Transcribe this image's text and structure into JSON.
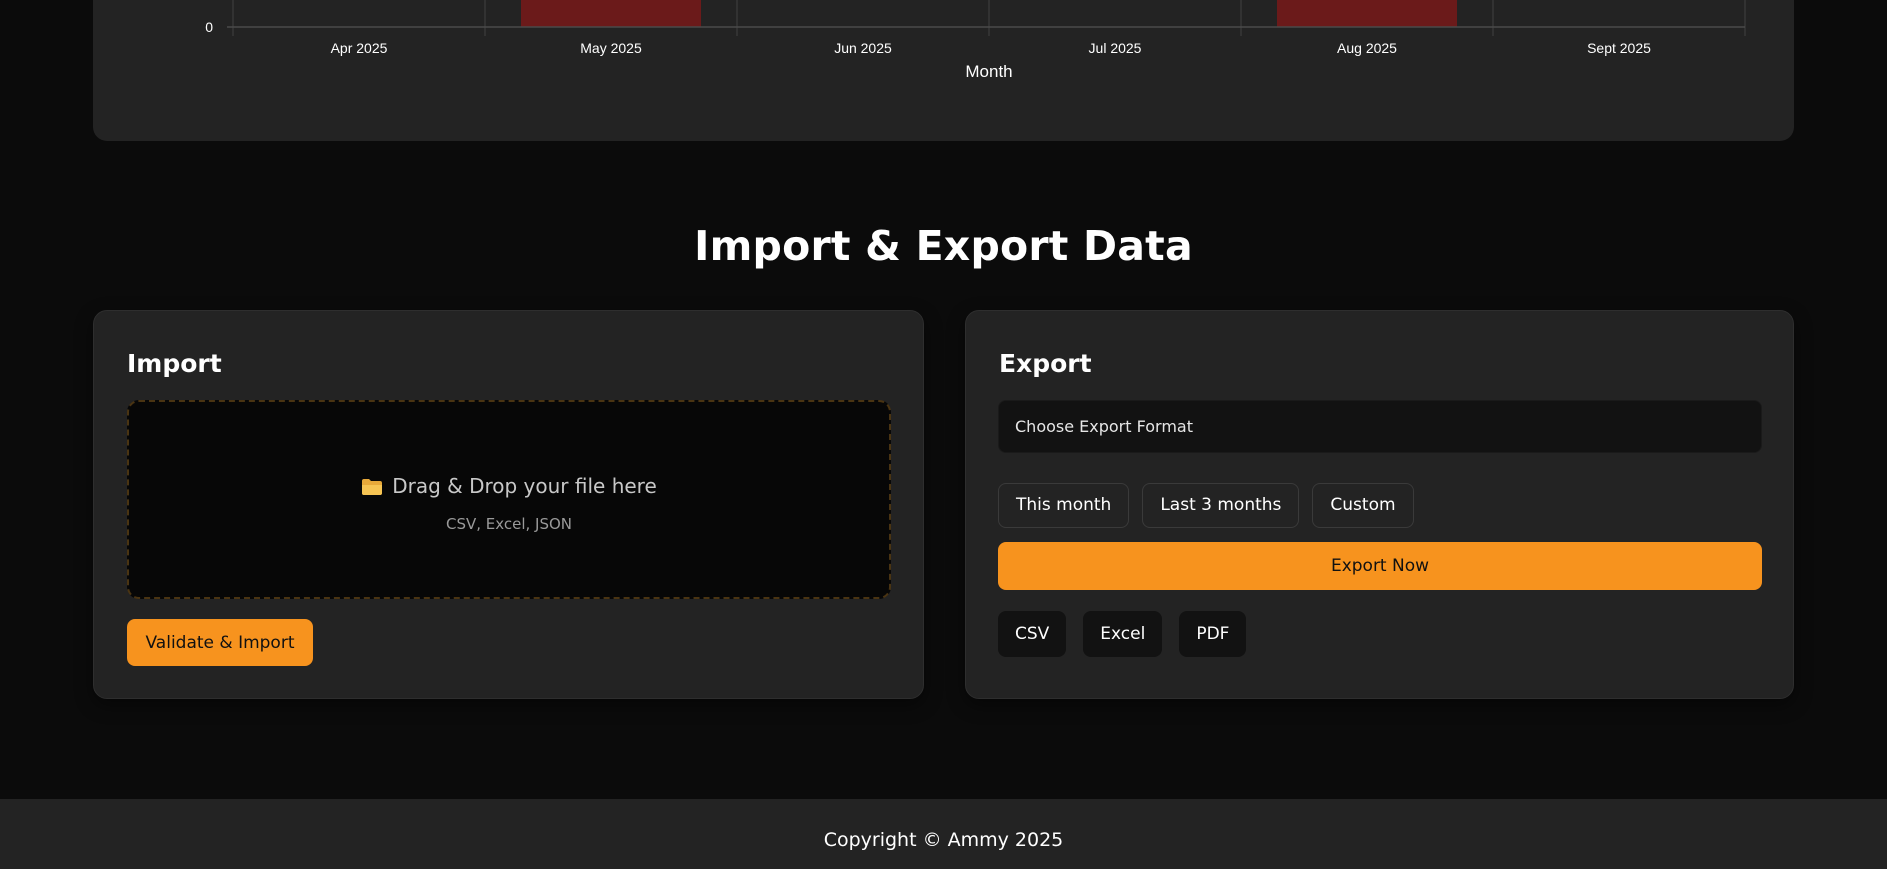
{
  "chart_data": {
    "type": "bar",
    "xlabel": "Month",
    "categories": [
      "Apr 2025",
      "May 2025",
      "Jun 2025",
      "Jul 2025",
      "Aug 2025",
      "Sept 2025"
    ],
    "y_tick_labels": [
      "0"
    ],
    "bar_color": "#6b1a1a",
    "grid": true
  },
  "section_title": "Import & Export Data",
  "import": {
    "heading": "Import",
    "dropzone_icon": "folder-icon",
    "dropzone_title": "Drag & Drop your file here",
    "dropzone_subtitle": "CSV, Excel, JSON",
    "validate_label": "Validate & Import"
  },
  "export": {
    "heading": "Export",
    "format_select": "Choose Export Format",
    "ranges": [
      "This month",
      "Last 3 months",
      "Custom"
    ],
    "export_label": "Export Now",
    "formats": [
      "CSV",
      "Excel",
      "PDF"
    ]
  },
  "footer": {
    "copyright": "Copyright © Ammy 2025"
  },
  "colors": {
    "accent": "#f7931e",
    "background": "#0b0b0b",
    "card": "#232323"
  }
}
